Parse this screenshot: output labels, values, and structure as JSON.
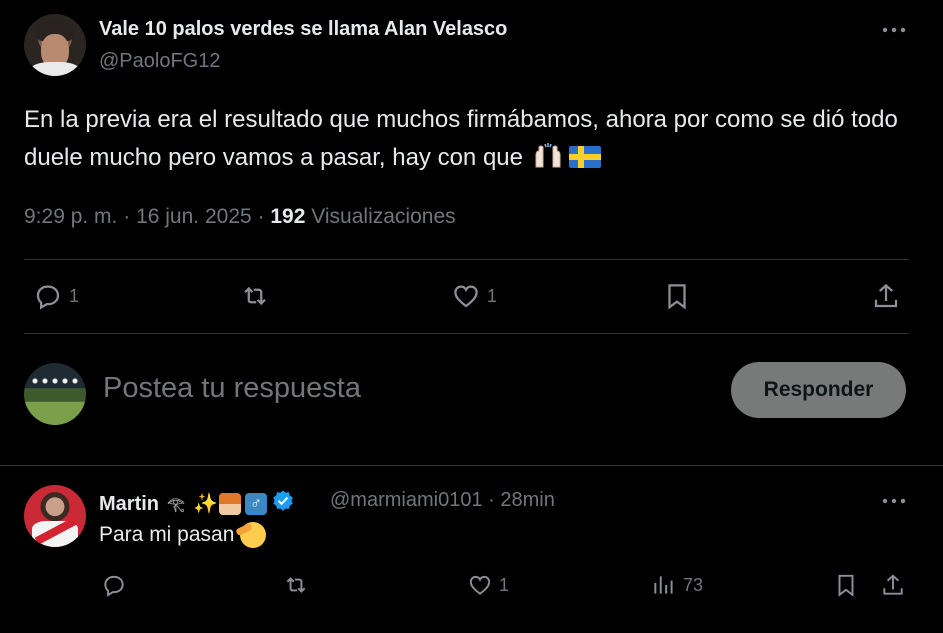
{
  "main_tweet": {
    "display_name": "Vale 10 palos verdes se llama Alan Velasco",
    "handle": "@PaoloFG12",
    "text": "En la previa era el resultado que muchos firmábamos, ahora por como se dió todo duele mucho pero vamos a pasar, hay con que",
    "emojis": [
      "raising-hands-emoji",
      "sweden-flag-emoji"
    ],
    "time": "9:29 p. m.",
    "date": "16 jun. 2025",
    "views_count": "192",
    "views_label": "Visualizaciones",
    "separator": "·",
    "actions": {
      "replies": "1",
      "retweets": "",
      "likes": "1"
    }
  },
  "reply_composer": {
    "placeholder": "Postea tu respuesta",
    "button_label": "Responder"
  },
  "reply": {
    "display_name": "Martin",
    "name_emojis": [
      "eye-of-horus-emoji",
      "sparkles-emoji",
      "mage-emoji",
      "male-sign-emoji"
    ],
    "verified": true,
    "handle": "@marmiami0101",
    "separator": "·",
    "time_ago": "28min",
    "text": "Para mi pasan",
    "text_emoji": "saluting-face-emoji",
    "actions": {
      "replies": "",
      "retweets": "",
      "likes": "1",
      "views": "73"
    }
  },
  "colors": {
    "background": "#000000",
    "text_primary": "#e7e9ea",
    "text_secondary": "#71767b",
    "divider": "#2f3336",
    "reply_button_bg": "#787a7a",
    "verified_blue": "#1d9bf0"
  }
}
